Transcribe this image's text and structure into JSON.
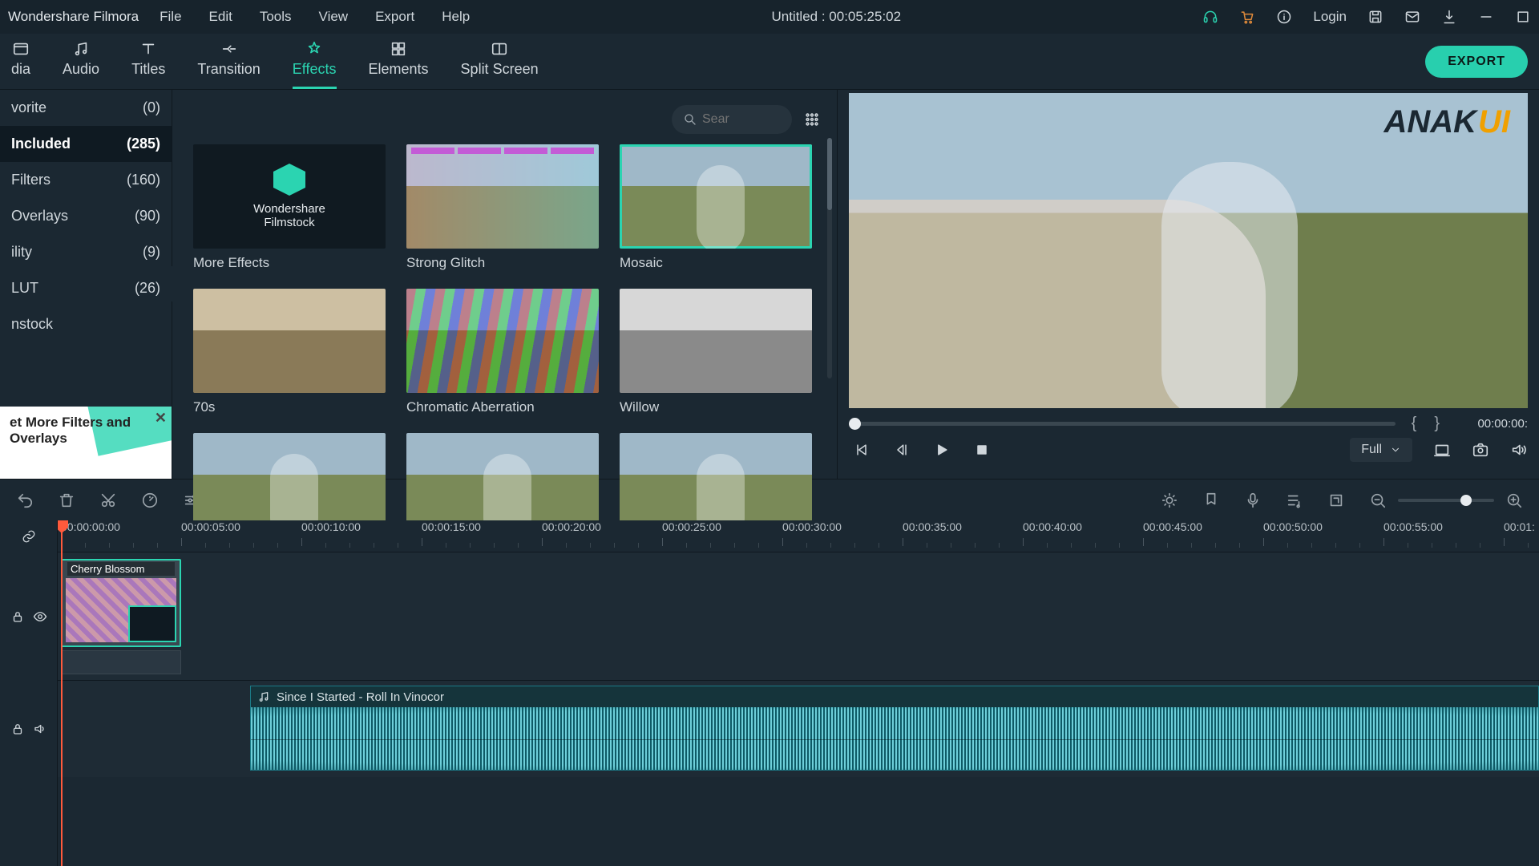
{
  "app_name": "Wondershare Filmora",
  "menu": [
    "File",
    "Edit",
    "Tools",
    "View",
    "Export",
    "Help"
  ],
  "doc_title": "Untitled : 00:05:25:02",
  "login_label": "Login",
  "tabs": [
    {
      "id": "media",
      "label": "dia"
    },
    {
      "id": "audio",
      "label": "Audio"
    },
    {
      "id": "titles",
      "label": "Titles"
    },
    {
      "id": "transition",
      "label": "Transition"
    },
    {
      "id": "effects",
      "label": "Effects"
    },
    {
      "id": "elements",
      "label": "Elements"
    },
    {
      "id": "splitscreen",
      "label": "Split Screen"
    }
  ],
  "active_tab": "effects",
  "export_label": "EXPORT",
  "sidebar": {
    "items": [
      {
        "label": "vorite",
        "count": "(0)"
      },
      {
        "label": "Included",
        "count": "(285)",
        "active": true
      },
      {
        "label": "Filters",
        "count": "(160)"
      },
      {
        "label": "Overlays",
        "count": "(90)"
      },
      {
        "label": "ility",
        "count": "(9)"
      },
      {
        "label": "LUT",
        "count": "(26)"
      },
      {
        "label": "nstock",
        "count": ""
      }
    ],
    "promo_text": "et More Filters and Overlays"
  },
  "search_placeholder": "Sear",
  "effects": [
    {
      "label": "More Effects",
      "kind": "more"
    },
    {
      "label": "Strong Glitch",
      "kind": "glitch"
    },
    {
      "label": "Mosaic",
      "kind": "vineyard",
      "selected": true
    },
    {
      "label": "70s",
      "kind": "sepia"
    },
    {
      "label": "Chromatic Aberration",
      "kind": "chroma"
    },
    {
      "label": "Willow",
      "kind": "willow"
    },
    {
      "label": "",
      "kind": "vineyard"
    },
    {
      "label": "",
      "kind": "vineyard"
    },
    {
      "label": "",
      "kind": "vineyard"
    }
  ],
  "filmstock_name": "Wondershare Filmstock",
  "preview": {
    "watermark": "ANAK",
    "watermark_suffix": "UI",
    "timecode": "00:00:00:",
    "quality": "Full"
  },
  "ruler_ticks": [
    "00:00:00:00",
    "00:00:05:00",
    "00:00:10:00",
    "00:00:15:00",
    "00:00:20:00",
    "00:00:25:00",
    "00:00:30:00",
    "00:00:35:00",
    "00:00:40:00",
    "00:00:45:00",
    "00:00:50:00",
    "00:00:55:00",
    "00:01:"
  ],
  "video_clip_label": "Cherry Blossom",
  "audio_clip_label": "Since I Started - Roll In Vinocor"
}
